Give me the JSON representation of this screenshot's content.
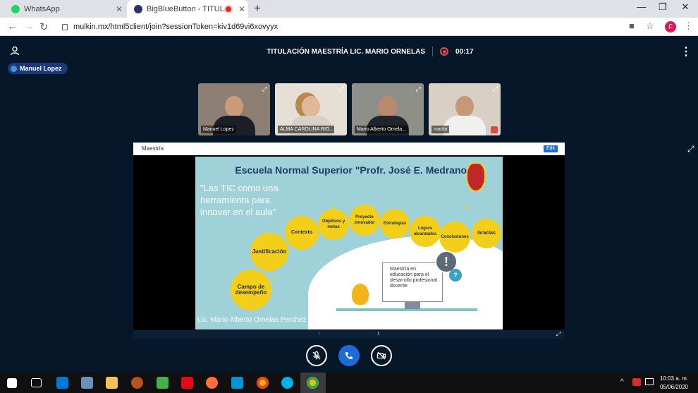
{
  "browser": {
    "tabs": [
      {
        "title": "WhatsApp",
        "color": "#25d366"
      },
      {
        "title": "BigBlueButton - TITULACIÓN",
        "color": "#283274"
      }
    ],
    "url": "mulkin.mx/html5client/join?sessionToken=kiv1d69vi6xovyyx",
    "profile_initial": "F"
  },
  "meeting": {
    "title": "TITULACIÓN MAESTRÍA LIC. MARIO ORNELAS",
    "timer": "00:17",
    "talking_user": "Manuel Lopez"
  },
  "webcams": [
    {
      "name": "Manuel Lopez",
      "bg": "#8d7f74",
      "skin": "#c89b7b",
      "shirt": "#1c1f28"
    },
    {
      "name": "ALMA CAROLINA RIO...",
      "bg": "#e6dfd6",
      "skin": "#e1b79a",
      "shirt": "#d9d0c5"
    },
    {
      "name": "Mario Alberto Ornela...",
      "bg": "#8f8f8a",
      "skin": "#b98a6e",
      "shirt": "#20252b"
    },
    {
      "name": "martin",
      "bg": "#d8d0c4",
      "skin": "#c79878",
      "shirt": "#f0f0ee"
    }
  ],
  "presentation": {
    "name": "Maestría",
    "edit_label": "Edit",
    "slide": {
      "title": "Escuela Normal Superior \"Profr. José E. Medrano R.\"",
      "quote": "\"Las TIC como una herramienta para innovar en el aula\"",
      "circles": [
        "Campo de desempeño",
        "Justificación",
        "Contexto",
        "Objetivos y metas",
        "Proyecto innovador",
        "Estrategias",
        "Logros alcanzados",
        "Conclusiones",
        "Gracias"
      ],
      "monitor_text": "Maestría en educación para el desarrollo profesional docente",
      "author": "Lic. Mario Alberto Ornelas Perchez"
    }
  },
  "taskbar": {
    "time": "10:03 a. m.",
    "date": "05/06/2020"
  }
}
